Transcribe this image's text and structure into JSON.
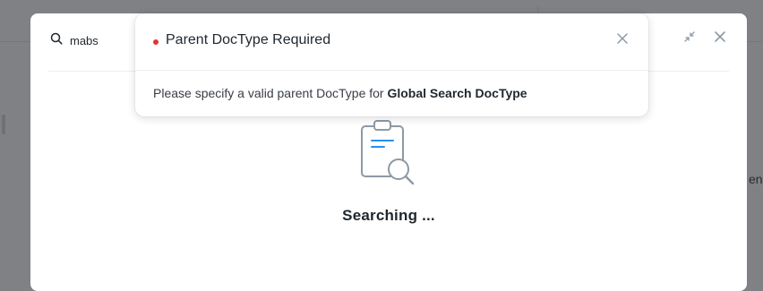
{
  "search": {
    "query": "mabs"
  },
  "empty_state": {
    "label": "Searching ..."
  },
  "toast": {
    "title": "Parent DocType Required",
    "message_prefix": "Please specify a valid parent DocType for ",
    "message_doctype": "Global Search DocType"
  },
  "icons": {
    "search": "search-icon",
    "collapse": "collapse-icon",
    "close": "close-icon",
    "toast_close": "close-icon",
    "empty": "clipboard-search-icon"
  },
  "colors": {
    "overlay": "#7f8185",
    "indicator_red": "#e03636",
    "illustration_blue": "#2490ef"
  }
}
